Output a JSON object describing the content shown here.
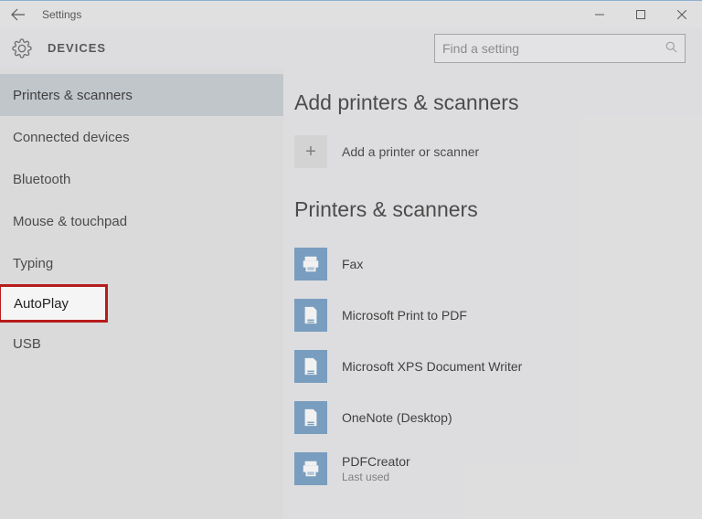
{
  "titlebar": {
    "title": "Settings"
  },
  "header": {
    "label": "DEVICES",
    "search_placeholder": "Find a setting"
  },
  "sidebar": {
    "items": [
      {
        "label": "Printers & scanners"
      },
      {
        "label": "Connected devices"
      },
      {
        "label": "Bluetooth"
      },
      {
        "label": "Mouse & touchpad"
      },
      {
        "label": "Typing"
      },
      {
        "label": "AutoPlay"
      },
      {
        "label": "USB"
      }
    ]
  },
  "main": {
    "section1_title": "Add printers & scanners",
    "add_label": "Add a printer or scanner",
    "section2_title": "Printers & scanners",
    "devices": [
      {
        "name": "Fax",
        "icon": "printer",
        "sub": ""
      },
      {
        "name": "Microsoft Print to PDF",
        "icon": "doc",
        "sub": ""
      },
      {
        "name": "Microsoft XPS Document Writer",
        "icon": "doc",
        "sub": ""
      },
      {
        "name": "OneNote (Desktop)",
        "icon": "doc",
        "sub": ""
      },
      {
        "name": "PDFCreator",
        "icon": "printer",
        "sub": "Last used"
      }
    ]
  }
}
